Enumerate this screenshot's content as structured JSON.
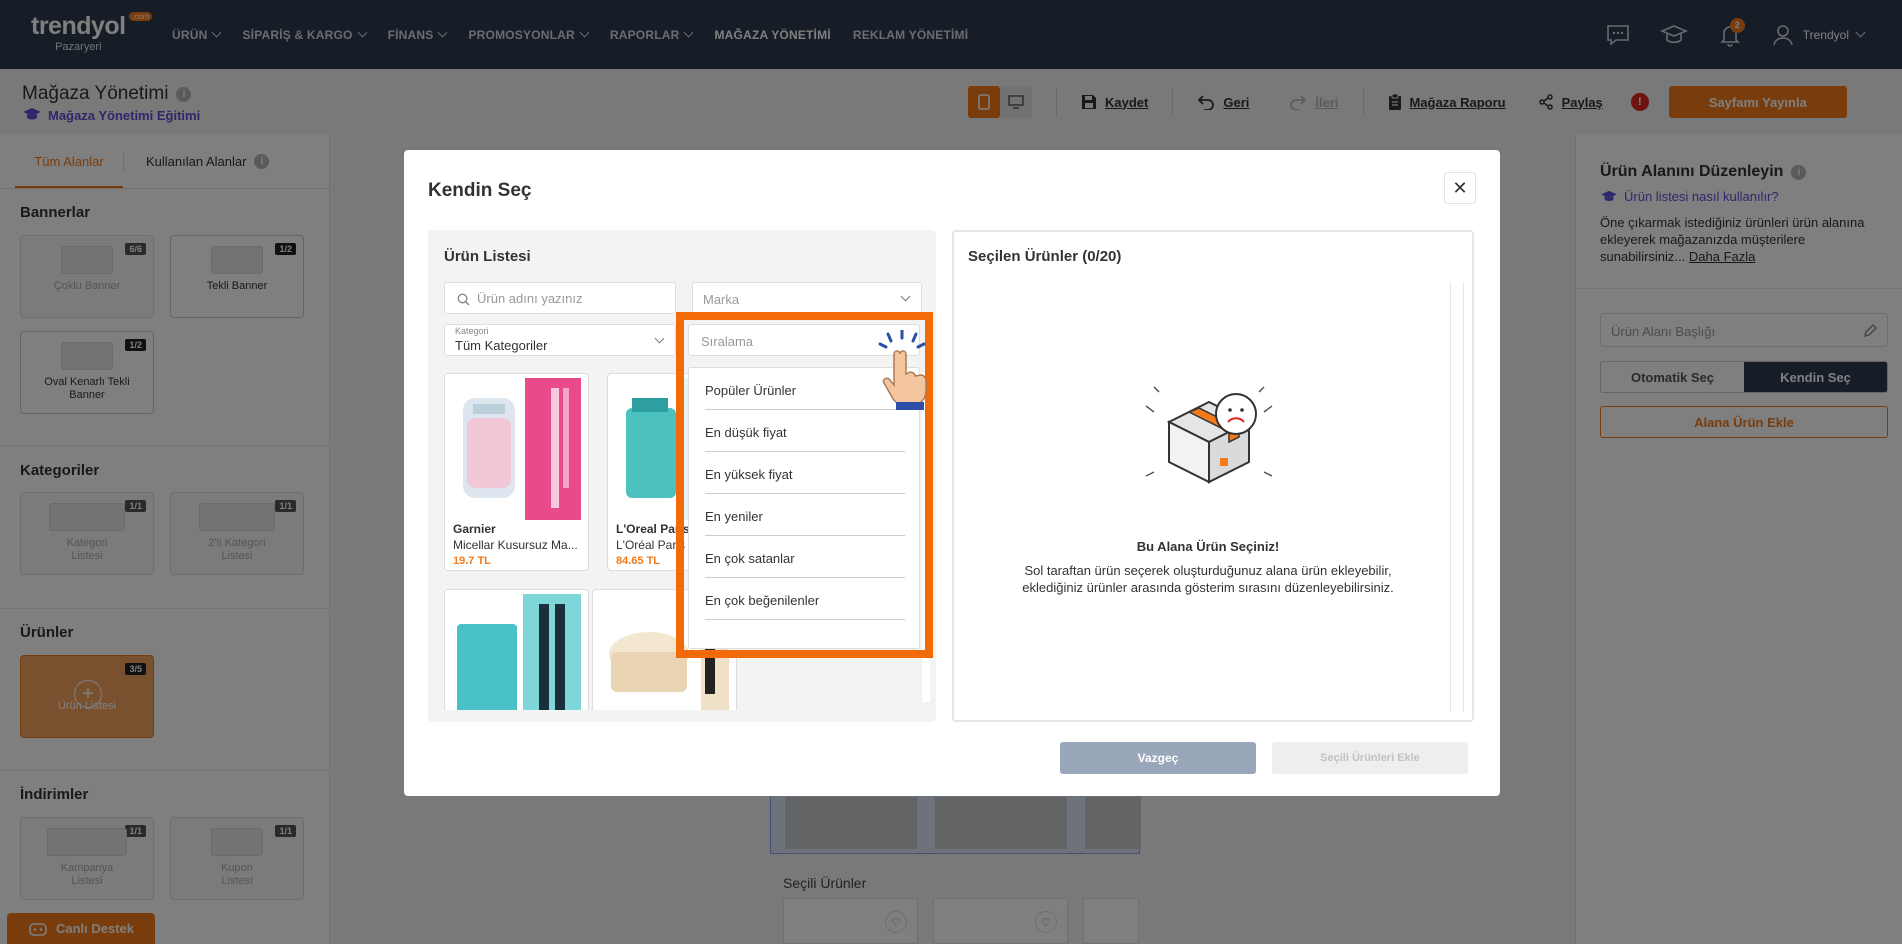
{
  "topnav": {
    "logo": {
      "brand": "trendyol",
      "sub": "Pazaryeri",
      "dotcom": ".com"
    },
    "items": [
      {
        "label": "ÜRÜN",
        "has_menu": true
      },
      {
        "label": "SİPARİŞ & KARGO",
        "has_menu": true
      },
      {
        "label": "FİNANS",
        "has_menu": true
      },
      {
        "label": "PROMOSYONLAR",
        "has_menu": true
      },
      {
        "label": "RAPORLAR",
        "has_menu": true
      },
      {
        "label": "MAĞAZA YÖNETİMİ",
        "has_menu": false,
        "active": true
      },
      {
        "label": "REKLAM YÖNETİMİ",
        "has_menu": false
      }
    ],
    "notification_count": "2",
    "user_name": "Trendyol"
  },
  "header": {
    "title": "Mağaza Yönetimi",
    "info": "i",
    "edu_link": "Mağaza Yönetimi Eğitimi",
    "save": "Kaydet",
    "back": "Geri",
    "forward": "İleri",
    "report": "Mağaza Raporu",
    "share": "Paylaş",
    "alert": "!",
    "publish": "Sayfamı Yayınla"
  },
  "left_panel": {
    "tabs": [
      "Tüm Alanlar",
      "Kullanılan Alanlar"
    ],
    "sections": {
      "banners": {
        "title": "Bannerlar",
        "items": [
          {
            "label": "Çoklu Banner",
            "count": "6/6"
          },
          {
            "label": "Tekli Banner",
            "count": "1/2"
          },
          {
            "label": "Oval Kenarlı Tekli Banner",
            "count": "1/2"
          }
        ]
      },
      "categories": {
        "title": "Kategoriler",
        "items": [
          {
            "label": "Kategori Listesi",
            "count": "1/1"
          },
          {
            "label": "2'li Kategori Listesi",
            "count": "1/1"
          }
        ]
      },
      "products": {
        "title": "Ürünler",
        "items": [
          {
            "label": "Ürün Listesi",
            "count": "3/5"
          }
        ]
      },
      "discounts": {
        "title": "İndirimler",
        "items": [
          {
            "label": "Kampanya Listesi",
            "count": "1/1"
          },
          {
            "label": "Kupon Listesi",
            "count": "1/1"
          }
        ]
      }
    },
    "live_support": "Canlı Destek"
  },
  "right_panel": {
    "title": "Ürün Alanını Düzenleyin",
    "help_link": "Ürün listesi nasıl kullanılır?",
    "description": "Öne çıkarmak istediğiniz ürünleri ürün alanına ekleyerek mağazanızda müşterilere sunabilirsiniz...",
    "more_link": "Daha Fazla",
    "title_placeholder": "Ürün Alanı Başlığı",
    "auto_select": "Otomatik Seç",
    "manual_select": "Kendin Seç",
    "add_product": "Alana Ürün Ekle"
  },
  "canvas": {
    "selected_title": "Seçili Ürünler"
  },
  "modal": {
    "title": "Kendin Seç",
    "close": "✕",
    "product_list": {
      "title": "Ürün Listesi",
      "search_placeholder": "Ürün adını yazınız",
      "brand_placeholder": "Marka",
      "category_label": "Kategori",
      "category_value": "Tüm Kategoriler",
      "sort_placeholder": "Sıralama",
      "products": [
        {
          "brand": "Garnier",
          "name": "Micellar Kusursuz Ma...",
          "price": "19.7 TL"
        },
        {
          "brand": "L'Oreal Paris",
          "name": "L'Oréal Paris ...",
          "price": "84.65 TL"
        },
        {
          "brand": "",
          "name": "",
          "price": ""
        },
        {
          "brand": "",
          "name": "",
          "price": ""
        }
      ]
    },
    "sort_options": [
      "Popüler Ürünler",
      "En düşük fiyat",
      "En yüksek fiyat",
      "En yeniler",
      "En çok satanlar",
      "En çok beğenilenler"
    ],
    "selected": {
      "title": "Seçilen Ürünler (0/20)",
      "empty_title": "Bu Alana Ürün Seçiniz!",
      "empty_desc": "Sol taraftan ürün seçerek oluşturduğunuz alana ürün ekleyebilir, eklediğiniz ürünler arasında gösterim sırasını düzenleyebilirsiniz."
    },
    "cancel": "Vazgeç",
    "add_selected": "Seçili Ürünleri Ekle"
  }
}
